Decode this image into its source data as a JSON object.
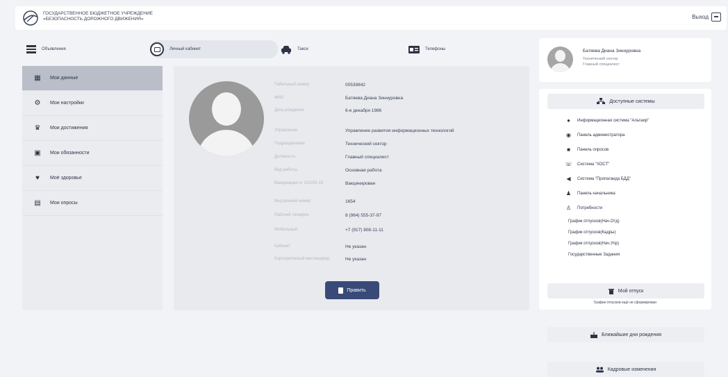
{
  "header": {
    "org_line1": "ГОСУДАРСТВЕННОЕ БЮДЖЕТНОЕ УЧРЕЖДЕНИЕ",
    "org_line2": "«БЕЗОПАСНОСТЬ ДОРОЖНОГО ДВИЖЕНИЯ»",
    "logout_label": "Выход"
  },
  "topnav": {
    "items": [
      {
        "label": "Объявления",
        "icon": "news-icon"
      },
      {
        "label": "Личный кабинет",
        "icon": "profile-card-icon"
      },
      {
        "label": "Такси",
        "icon": "car-icon"
      },
      {
        "label": "Телефоны",
        "icon": "phonebook-icon"
      }
    ]
  },
  "sidebar": {
    "items": [
      {
        "label": "Мои данные",
        "icon": "id-card-icon"
      },
      {
        "label": "Мои настройки",
        "icon": "gear-icon"
      },
      {
        "label": "Мои достижения",
        "icon": "trophy-icon"
      },
      {
        "label": "Мои обязанности",
        "icon": "briefcase-icon"
      },
      {
        "label": "Моё здоровье",
        "icon": "heart-icon"
      },
      {
        "label": "Мои опросы",
        "icon": "poll-icon"
      }
    ]
  },
  "profile_info": {
    "rows": [
      {
        "label": "Табельный номер",
        "value": "00539842"
      },
      {
        "label": "ФИО",
        "value": "Батяева Диана Зиннуровна"
      },
      {
        "label": "Дата рождения",
        "value": "6-е декабря 1986"
      },
      {
        "label": "Управление",
        "value": "Управление развития информационных технологий"
      },
      {
        "label": "Подразделение",
        "value": "Технический сектор"
      },
      {
        "label": "Должность",
        "value": "Главный специалист"
      },
      {
        "label": "Вид работы",
        "value": "Основная работа"
      },
      {
        "label": "Вакцинация от COVID-19",
        "value": "Вакцинирован"
      },
      {
        "label": "Внутренний номер",
        "value": "1654"
      },
      {
        "label": "Рабочий телефон",
        "value": "8 (964) 555-37-97"
      },
      {
        "label": "Мобильный",
        "value": "+7 (917) 808-11-11"
      },
      {
        "label": "Кабинет",
        "value": "Не указан"
      },
      {
        "label": "Корпоративный мессенджер",
        "value": "Не указан"
      }
    ],
    "edit_label": "Править"
  },
  "right_profile": {
    "name": "Батяева Диана Зиннуровна",
    "line1": "Технический сектор",
    "line2": "Главный специалист"
  },
  "systems": {
    "title": "Доступные системы",
    "items": [
      {
        "label": "Информационная система \"Альтаир\"",
        "icon": "globe-icon"
      },
      {
        "label": "Панель администратора",
        "icon": "shield-icon"
      },
      {
        "label": "Панель опросов",
        "icon": "poll-icon"
      },
      {
        "label": "Система \"ХОСТ\"",
        "icon": "headset-icon"
      },
      {
        "label": "Система \"Пропаганда БДД\"",
        "icon": "megaphone-icon"
      },
      {
        "label": "Панель начальника",
        "icon": "user-tie-icon"
      },
      {
        "label": "Потребности",
        "icon": "users-icon"
      }
    ],
    "links": [
      "График отпусков(Нач.Отд)",
      "График отпусков(Кадры)",
      "График отпусков(Нач.Упр)",
      "Государственные Задания"
    ]
  },
  "vacation": {
    "title": "Мой отпуск",
    "note": "График отпусков ещё не сформирован"
  },
  "birthdays": {
    "title": "Ближайшие дни рождения"
  },
  "hr": {
    "title": "Кадровые изменения"
  }
}
